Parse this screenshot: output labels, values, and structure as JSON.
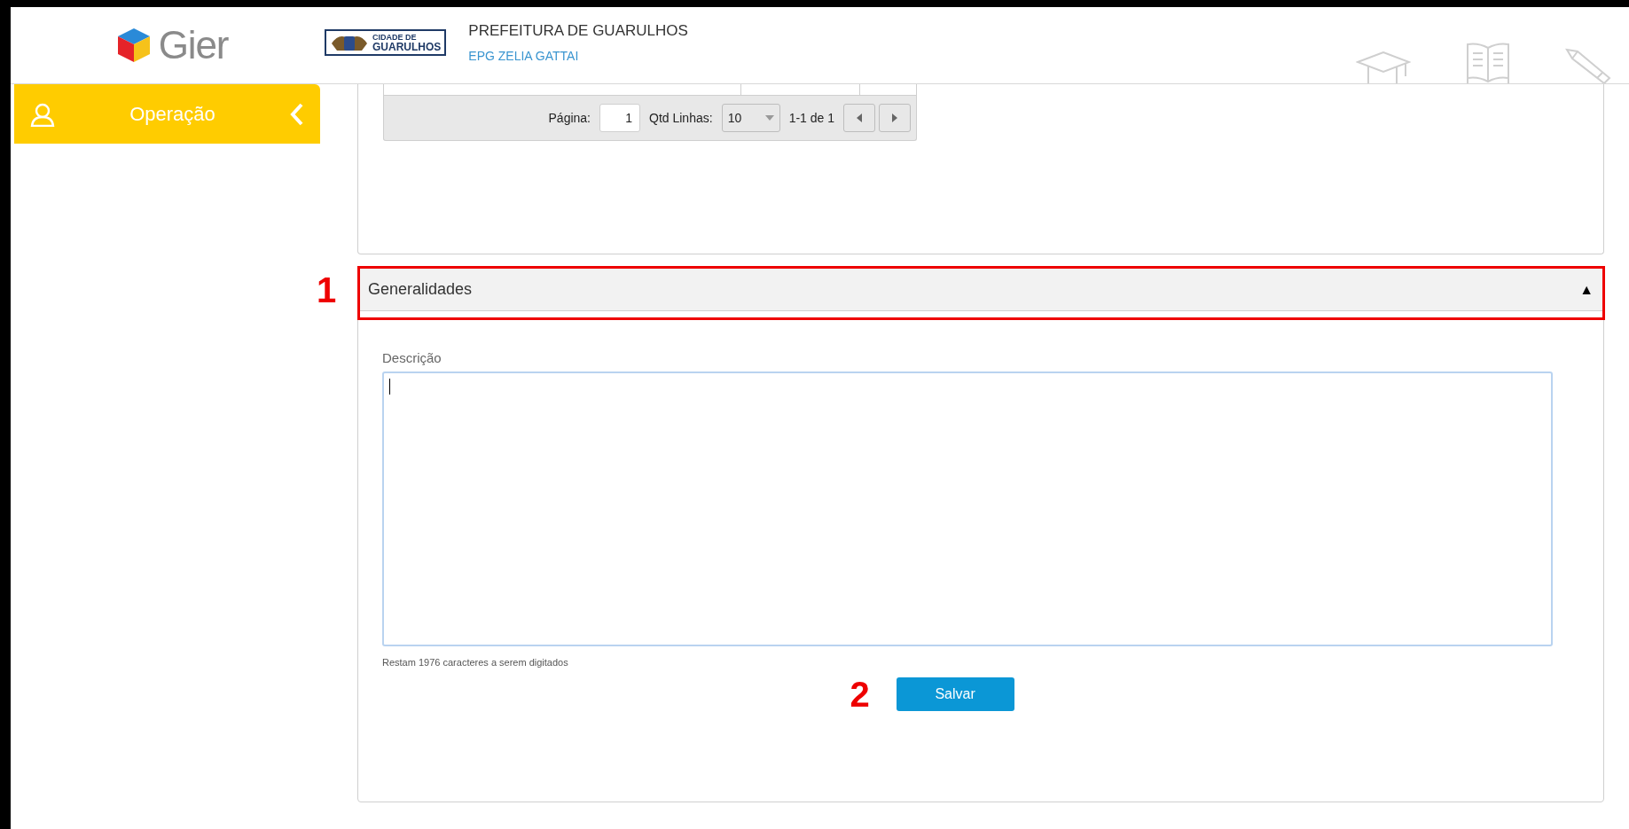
{
  "header": {
    "logo_text": "Gier",
    "emblem_text": [
      "CIDADE DE",
      "GUARULHOS"
    ],
    "org_title": "PREFEITURA DE GUARULHOS",
    "org_subtitle": "EPG ZELIA GATTAI"
  },
  "sidebar": {
    "items": [
      {
        "label": "Operação",
        "selected": true
      }
    ]
  },
  "pager": {
    "page_label": "Página:",
    "page_value": "1",
    "rows_label": "Qtd Linhas:",
    "rows_value": "10",
    "range": "1-1 de 1"
  },
  "section": {
    "title": "Generalidades",
    "toggle": "▲",
    "expanded": true,
    "field_label": "Descrição",
    "remaining": "Restam 1976 caracteres a serem digitados",
    "button": "Salvar"
  },
  "annotations": [
    {
      "label": "1"
    },
    {
      "label": "2"
    }
  ]
}
